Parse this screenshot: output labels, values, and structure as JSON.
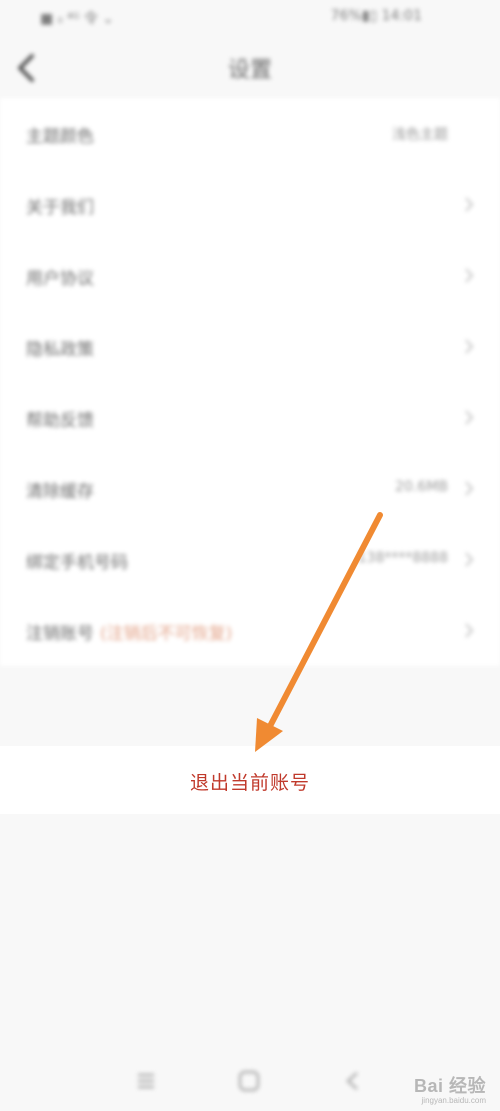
{
  "status_bar": {
    "left": "■ ᵢₗ ⁴ᴳ 令 ⌄",
    "right": "76%▮▯ 14:01"
  },
  "header": {
    "title": "设置"
  },
  "settings": [
    {
      "label": "主题颜色",
      "value": "浅色主题",
      "chevron": false
    },
    {
      "label": "关于我们",
      "value": "",
      "chevron": true
    },
    {
      "label": "用户协议",
      "value": "",
      "chevron": true
    },
    {
      "label": "隐私政策",
      "value": "",
      "chevron": true
    },
    {
      "label": "帮助反馈",
      "value": "",
      "chevron": true
    },
    {
      "label": "清除缓存",
      "value": "20.6MB",
      "chevron": true
    },
    {
      "label": "绑定手机号码",
      "value": "138****8888",
      "chevron": true
    },
    {
      "label": "注销账号",
      "warning": "(注销后不可恢复)",
      "value": "",
      "chevron": true
    }
  ],
  "logout": {
    "label": "退出当前账号"
  },
  "annotation": {
    "arrow_color": "#f08a32"
  },
  "watermark": {
    "text": "Bai 经验",
    "sub": "jingyan.baidu.com"
  }
}
